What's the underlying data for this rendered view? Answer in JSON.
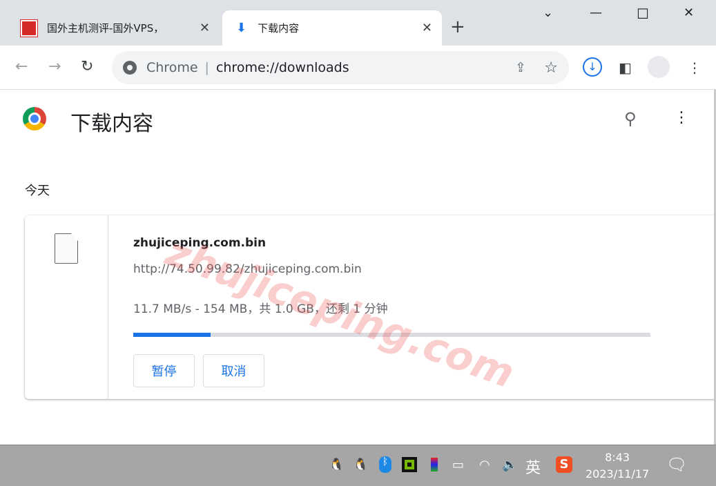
{
  "tabs": [
    {
      "title": "国外主机测评-国外VPS，",
      "active": false
    },
    {
      "title": "下载内容",
      "active": true
    }
  ],
  "omnibox": {
    "origin": "Chrome",
    "url": "chrome://downloads"
  },
  "page": {
    "title": "下载内容",
    "section": "今天"
  },
  "download": {
    "filename": "zhujiceping.com.bin",
    "url": "http://74.50.99.82/zhujiceping.com.bin",
    "status": "11.7 MB/s - 154 MB，共 1.0 GB，还剩 1 分钟",
    "progress_percent": 15,
    "pause_label": "暂停",
    "cancel_label": "取消"
  },
  "watermark": "zhujiceping.com",
  "taskbar": {
    "ime": "英",
    "time": "8:43",
    "date": "2023/11/17"
  },
  "colors": {
    "accent": "#1a73e8"
  }
}
